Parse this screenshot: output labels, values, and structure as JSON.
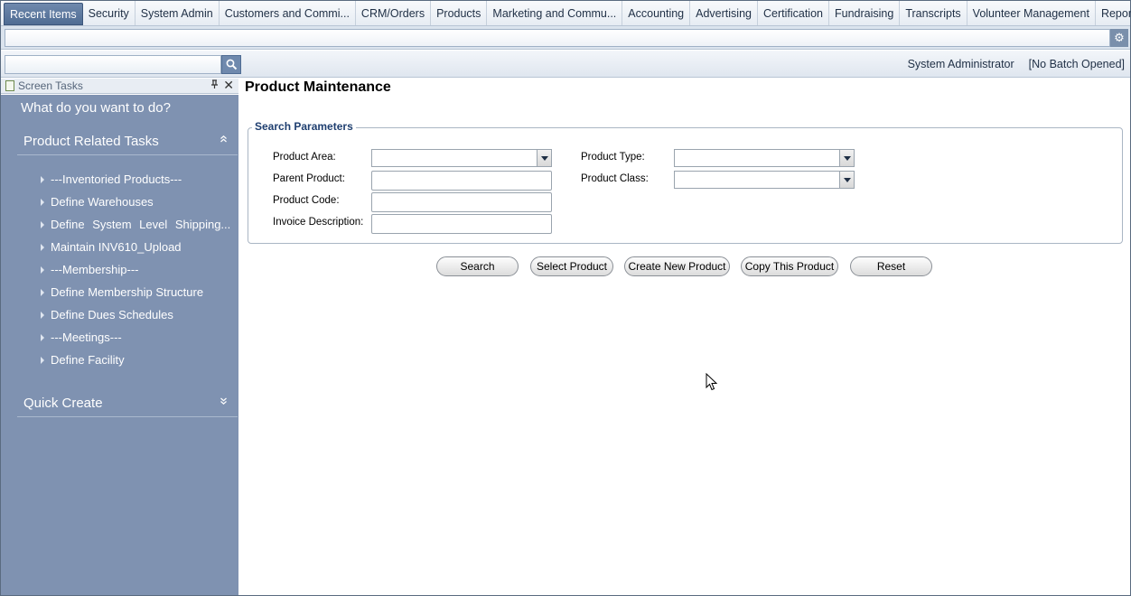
{
  "tabs": [
    {
      "label": "Recent Items",
      "active": true
    },
    {
      "label": "Security"
    },
    {
      "label": "System Admin"
    },
    {
      "label": "Customers and Commi..."
    },
    {
      "label": "CRM/Orders"
    },
    {
      "label": "Products"
    },
    {
      "label": "Marketing and Commu..."
    },
    {
      "label": "Accounting"
    },
    {
      "label": "Advertising"
    },
    {
      "label": "Certification"
    },
    {
      "label": "Fundraising"
    },
    {
      "label": "Transcripts"
    },
    {
      "label": "Volunteer Management"
    },
    {
      "label": "Reporting"
    }
  ],
  "header": {
    "user": "System Administrator",
    "batch": "[No Batch Opened]",
    "search_value": ""
  },
  "sidebar": {
    "panel_title": "Screen Tasks",
    "prompt": "What do you want to do?",
    "sections": {
      "product_tasks": "Product Related Tasks",
      "quick_create": "Quick Create"
    },
    "items": [
      "---Inventoried Products---",
      "Define Warehouses",
      "Define System Level Shipping...",
      "Maintain INV610_Upload",
      "---Membership---",
      "Define Membership Structure",
      "Define Dues Schedules",
      "---Meetings---",
      "Define Facility"
    ]
  },
  "main": {
    "title": "Product Maintenance",
    "search_params_legend": "Search Parameters",
    "fields": {
      "product_area": {
        "label": "Product Area:",
        "value": ""
      },
      "parent_product": {
        "label": "Parent Product:",
        "value": ""
      },
      "product_code": {
        "label": "Product Code:",
        "value": ""
      },
      "invoice_description": {
        "label": "Invoice Description:",
        "value": ""
      },
      "product_type": {
        "label": "Product Type:",
        "value": ""
      },
      "product_class": {
        "label": "Product Class:",
        "value": ""
      }
    },
    "buttons": {
      "search": "Search",
      "select_product": "Select Product",
      "create_new_product": "Create New Product",
      "copy_this_product": "Copy This Product",
      "reset": "Reset"
    }
  },
  "colors": {
    "sidebar_bg": "#7f92b1",
    "active_tab": "#5a77a0",
    "legend_text": "#1f3f70"
  }
}
